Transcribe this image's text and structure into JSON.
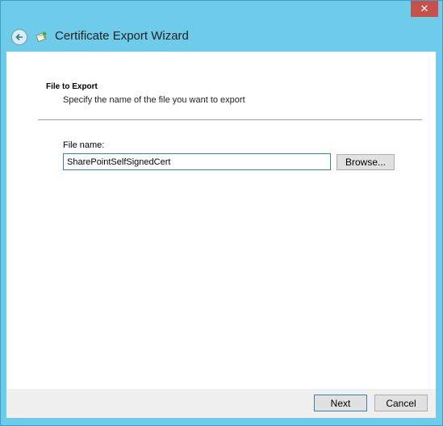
{
  "titlebar": {
    "close_label": "✕"
  },
  "header": {
    "title": "Certificate Export Wizard",
    "back_icon": "back-arrow-icon",
    "wizard_icon": "certificate-icon"
  },
  "step": {
    "heading": "File to Export",
    "description": "Specify the name of the file you want to export"
  },
  "form": {
    "file_name_label": "File name:",
    "file_name_value": "SharePointSelfSignedCert",
    "browse_label": "Browse..."
  },
  "footer": {
    "next_label": "Next",
    "cancel_label": "Cancel"
  },
  "colors": {
    "window_frame": "#6fcbea",
    "close_button": "#c7504a",
    "content_bg": "#ffffff",
    "footer_bg": "#f0f0f0"
  }
}
